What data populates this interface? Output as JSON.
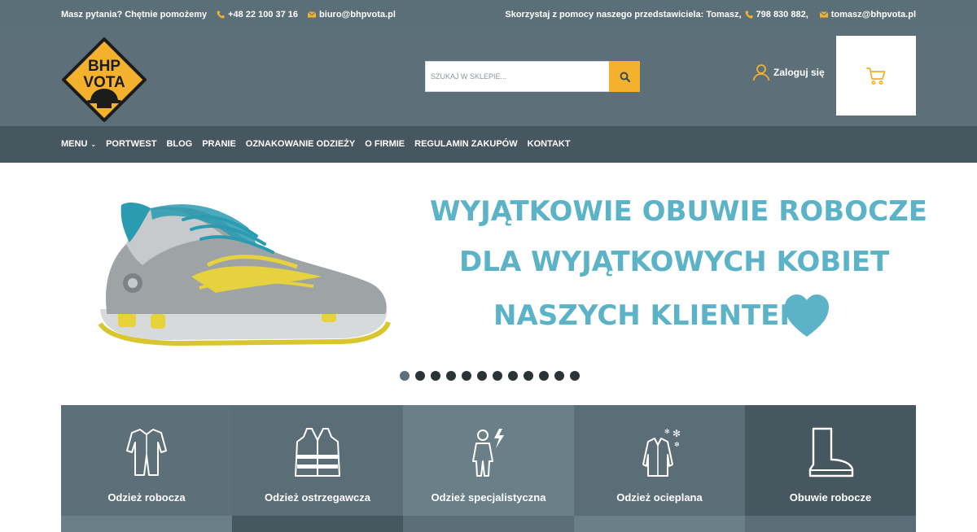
{
  "topbar": {
    "left": {
      "question": "Masz pytania? Chętnie pomożemy",
      "phone": "+48 22 100 37 16",
      "email": "biuro@bhpvota.pl"
    },
    "right": {
      "rep_text": "Skorzystaj z pomocy naszego przedstawiciela: Tomasz,",
      "rep_phone": "798 830 882,",
      "rep_email": "tomasz@bhpvota.pl"
    }
  },
  "header": {
    "logo_line1": "BHP",
    "logo_line2": "VOTA",
    "search_placeholder": "SZUKAJ W SKLEPIE...",
    "login_label": "Zaloguj się"
  },
  "nav": {
    "items": [
      "MENU",
      "PORTWEST",
      "BLOG",
      "PRANIE",
      "OZNAKOWANIE ODZIEŻY",
      "O FIRMIE",
      "REGULAMIN ZAKUPÓW",
      "KONTAKT"
    ]
  },
  "hero": {
    "line1": "WYJĄTKOWIE OBUWIE ROBOCZE",
    "line2": "DLA WYJĄTKOWYCH KOBIET",
    "line3": "NASZYCH KLIENTEK",
    "slide_count": 12,
    "active_slide": 1
  },
  "categories": [
    {
      "label": "Odzież robocza",
      "icon": "coverall-icon"
    },
    {
      "label": "Odzież ostrzegawcza",
      "icon": "hi-vis-vest-icon"
    },
    {
      "label": "Odzież specjalistyczna",
      "icon": "protective-suit-icon"
    },
    {
      "label": "Odzież ocieplana",
      "icon": "winter-jacket-icon"
    },
    {
      "label": "Obuwie robocze",
      "icon": "boot-icon"
    }
  ],
  "colors": {
    "topbar_bg": "#5b6f78",
    "header_bg": "#5d7079",
    "nav_bg": "#47575f",
    "accent": "#f3b12d",
    "hero_text": "#5cb3c7"
  }
}
